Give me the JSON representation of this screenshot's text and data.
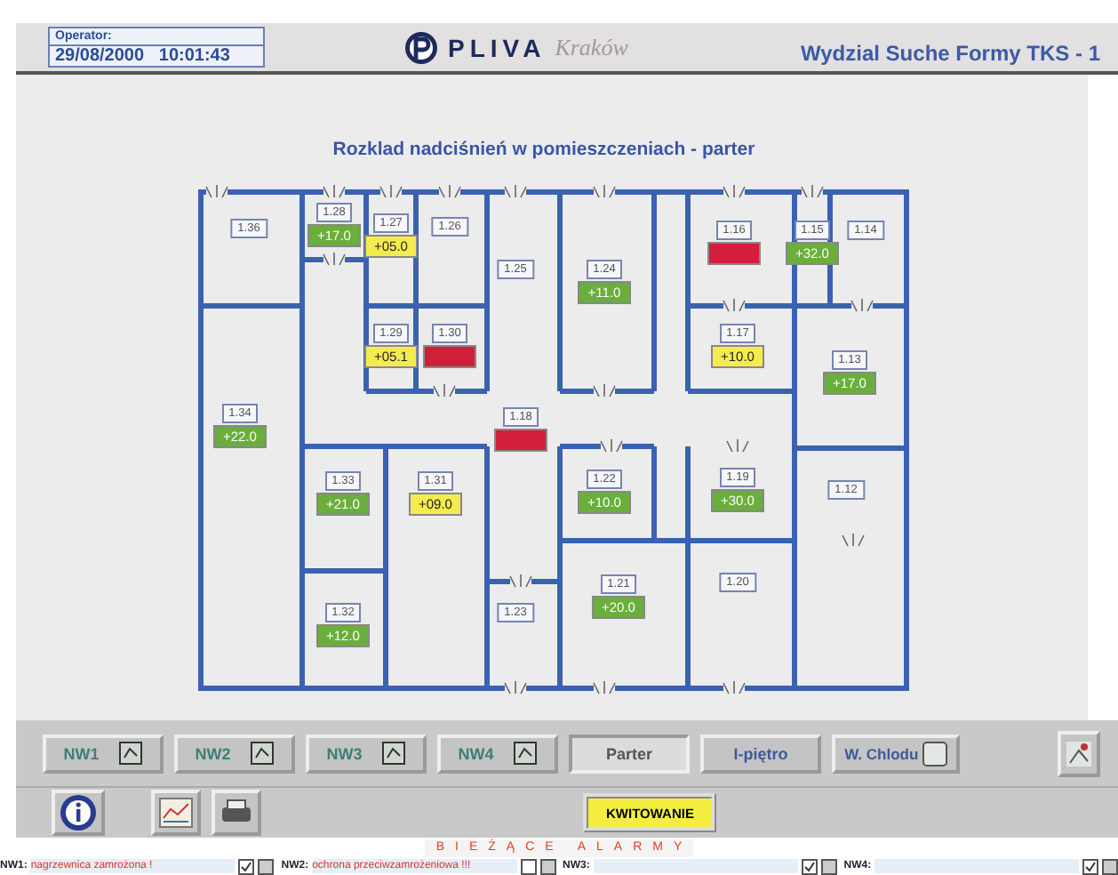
{
  "header": {
    "operator_label": "Operator:",
    "datetime": "29/08/2000   10:01:43",
    "logo": "PLIVA",
    "logo_sub": "Kraków",
    "department": "Wydzial Suche Formy TKS - 1"
  },
  "plan": {
    "title": "Rozklad nadciśnień w pomieszczeniach - parter",
    "rooms": [
      {
        "label": "1.36"
      },
      {
        "label": "1.28",
        "value": "+17.0",
        "color": "#6aae3c"
      },
      {
        "label": "1.27",
        "value": "+05.0",
        "color": "#f4ec4e"
      },
      {
        "label": "1.26"
      },
      {
        "label": "1.25"
      },
      {
        "label": "1.24",
        "value": "+11.0",
        "color": "#6aae3c"
      },
      {
        "label": "1.16",
        "color": "#d11f3c"
      },
      {
        "label": "1.15",
        "value": "+32.0",
        "color": "#6aae3c"
      },
      {
        "label": "1.14"
      },
      {
        "label": "1.29",
        "value": "+05.1",
        "color": "#f4ec4e"
      },
      {
        "label": "1.30",
        "color": "#d11f3c"
      },
      {
        "label": "1.17",
        "value": "+10.0",
        "color": "#f4ec4e"
      },
      {
        "label": "1.13",
        "value": "+17.0",
        "color": "#6aae3c"
      },
      {
        "label": "1.34",
        "value": "+22.0",
        "color": "#6aae3c"
      },
      {
        "label": "1.18",
        "color": "#d11f3c"
      },
      {
        "label": "1.33",
        "value": "+21.0",
        "color": "#6aae3c"
      },
      {
        "label": "1.31",
        "value": "+09.0",
        "color": "#f4ec4e"
      },
      {
        "label": "1.22",
        "value": "+10.0",
        "color": "#6aae3c"
      },
      {
        "label": "1.19",
        "value": "+30.0",
        "color": "#6aae3c"
      },
      {
        "label": "1.12"
      },
      {
        "label": "1.32",
        "value": "+12.0",
        "color": "#6aae3c"
      },
      {
        "label": "1.23"
      },
      {
        "label": "1.21",
        "value": "+20.0",
        "color": "#6aae3c"
      },
      {
        "label": "1.20"
      }
    ]
  },
  "nav_buttons": [
    {
      "label": "NW1",
      "kind": "unit",
      "selected": false
    },
    {
      "label": "NW2",
      "kind": "unit",
      "selected": false
    },
    {
      "label": "NW3",
      "kind": "unit",
      "selected": false
    },
    {
      "label": "NW4",
      "kind": "unit",
      "selected": false
    },
    {
      "label": "Parter",
      "kind": "floor",
      "selected": true
    },
    {
      "label": "I-piętro",
      "kind": "floor",
      "selected": false
    },
    {
      "label": "W. Chlodu",
      "kind": "toggle",
      "selected": false
    }
  ],
  "ack_button": "KWITOWANIE",
  "alarms": {
    "heading": "BIEŻĄCE ALARMY",
    "items": [
      {
        "label": "NW1:",
        "message": "nagrzewnica zamrożona !",
        "checked": true
      },
      {
        "label": "NW2:",
        "message": "ochrona przeciwzamrożeniowa !!!",
        "checked": false
      },
      {
        "label": "NW3:",
        "checked": true
      },
      {
        "label": "NW4:",
        "checked": true
      }
    ]
  }
}
